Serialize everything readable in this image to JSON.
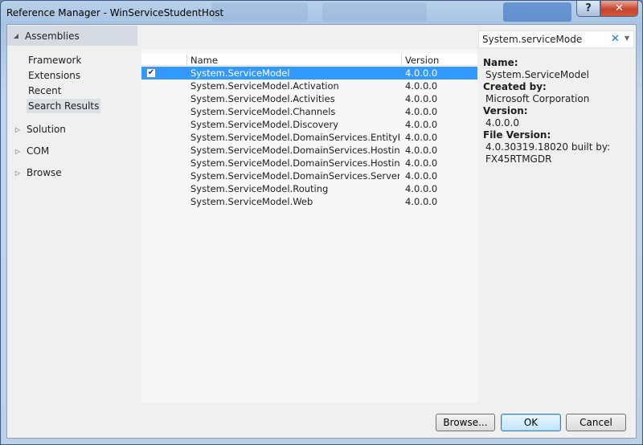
{
  "window": {
    "title": "Reference Manager - WinServiceStudentHost",
    "help_label": "?",
    "close_label": "✕"
  },
  "sidebar": {
    "header": "Assemblies",
    "sub_items": [
      "Framework",
      "Extensions",
      "Recent",
      "Search Results"
    ],
    "groups": [
      "Solution",
      "COM",
      "Browse"
    ]
  },
  "list": {
    "columns": [
      "Name",
      "Version"
    ],
    "rows": [
      {
        "name": "System.ServiceModel",
        "version": "4.0.0.0",
        "checked": true
      },
      {
        "name": "System.ServiceModel.Activation",
        "version": "4.0.0.0"
      },
      {
        "name": "System.ServiceModel.Activities",
        "version": "4.0.0.0"
      },
      {
        "name": "System.ServiceModel.Channels",
        "version": "4.0.0.0"
      },
      {
        "name": "System.ServiceModel.Discovery",
        "version": "4.0.0.0"
      },
      {
        "name": "System.ServiceModel.DomainServices.EntityFr...",
        "version": "4.0.0.0"
      },
      {
        "name": "System.ServiceModel.DomainServices.Hosting",
        "version": "4.0.0.0"
      },
      {
        "name": "System.ServiceModel.DomainServices.Hosting...",
        "version": "4.0.0.0"
      },
      {
        "name": "System.ServiceModel.DomainServices.Server",
        "version": "4.0.0.0"
      },
      {
        "name": "System.ServiceModel.Routing",
        "version": "4.0.0.0"
      },
      {
        "name": "System.ServiceModel.Web",
        "version": "4.0.0.0"
      }
    ]
  },
  "search": {
    "value": "System.serviceMode",
    "clear_glyph": "✕",
    "dropdown_glyph": "▼"
  },
  "details": {
    "name_label": "Name:",
    "name_value": "System.ServiceModel",
    "created_label": "Created by:",
    "created_value": "Microsoft Corporation",
    "version_label": "Version:",
    "version_value": "4.0.0.0",
    "file_version_label": "File Version:",
    "file_version_value_1": "4.0.30319.18020 built by:",
    "file_version_value_2": "FX45RTMGDR"
  },
  "footer": {
    "browse": "Browse...",
    "ok": "OK",
    "cancel": "Cancel"
  },
  "icons": {
    "expanded": "expanded-triangle-icon",
    "collapsed": "collapsed-triangle-icon",
    "check": "checkmark-icon"
  },
  "colors": {
    "selection": "#3399ff",
    "sidebar_header": "#d6dbe3",
    "close_button": "#c7442c"
  }
}
